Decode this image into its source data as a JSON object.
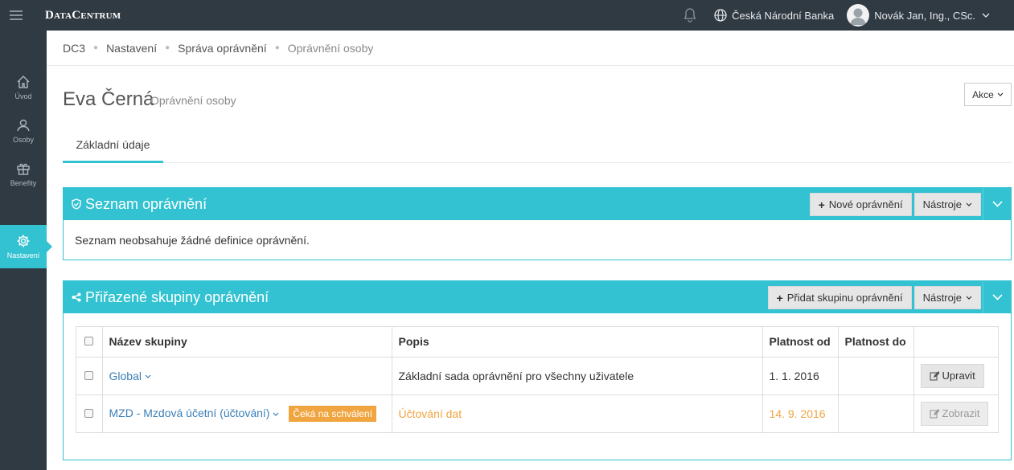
{
  "topbar": {
    "brand": "DataCentrum",
    "organization": "Česká Národní Banka",
    "user": "Novák Jan, Ing., CSc."
  },
  "sidebar": {
    "items": [
      {
        "label": "Úvod",
        "icon": "home-icon"
      },
      {
        "label": "Osoby",
        "icon": "persons-icon"
      },
      {
        "label": "Benefity",
        "icon": "gift-icon"
      },
      {
        "label": "Nastavení",
        "icon": "gear-icon",
        "active": true
      }
    ]
  },
  "breadcrumb": [
    "DC3",
    "Nastavení",
    "Správa oprávnění",
    "Oprávnění osoby"
  ],
  "page": {
    "title": "Eva Černá",
    "subtitle": "Oprávnění osoby",
    "actions_label": "Akce"
  },
  "tabs": [
    {
      "label": "Základní údaje",
      "active": true
    }
  ],
  "panel_permissions": {
    "title": "Seznam oprávnění",
    "new_button": "Nové oprávnění",
    "tools_button": "Nástroje",
    "empty_message": "Seznam neobsahuje žádné definice oprávnění."
  },
  "panel_groups": {
    "title": "Přiřazené skupiny oprávnění",
    "add_button": "Přidat skupinu oprávnění",
    "tools_button": "Nástroje",
    "columns": [
      "Název skupiny",
      "Popis",
      "Platnost od",
      "Platnost do"
    ],
    "rows": [
      {
        "name": "Global",
        "badge": "",
        "description": "Základní sada oprávnění pro všechny uživatele",
        "valid_from": "1. 1. 2016",
        "valid_to": "",
        "action": "Upravit",
        "pending": false
      },
      {
        "name": "MZD - Mzdová účetní (účtování)",
        "badge": "Čeká na schválení",
        "description": "Účtování dat",
        "valid_from": "14. 9. 2016",
        "valid_to": "",
        "action": "Zobrazit",
        "pending": true
      }
    ]
  },
  "colors": {
    "accent": "#33c2d1",
    "sidebar_bg": "#2f3a43",
    "warning": "#f0a540",
    "link": "#3a7fb8"
  }
}
